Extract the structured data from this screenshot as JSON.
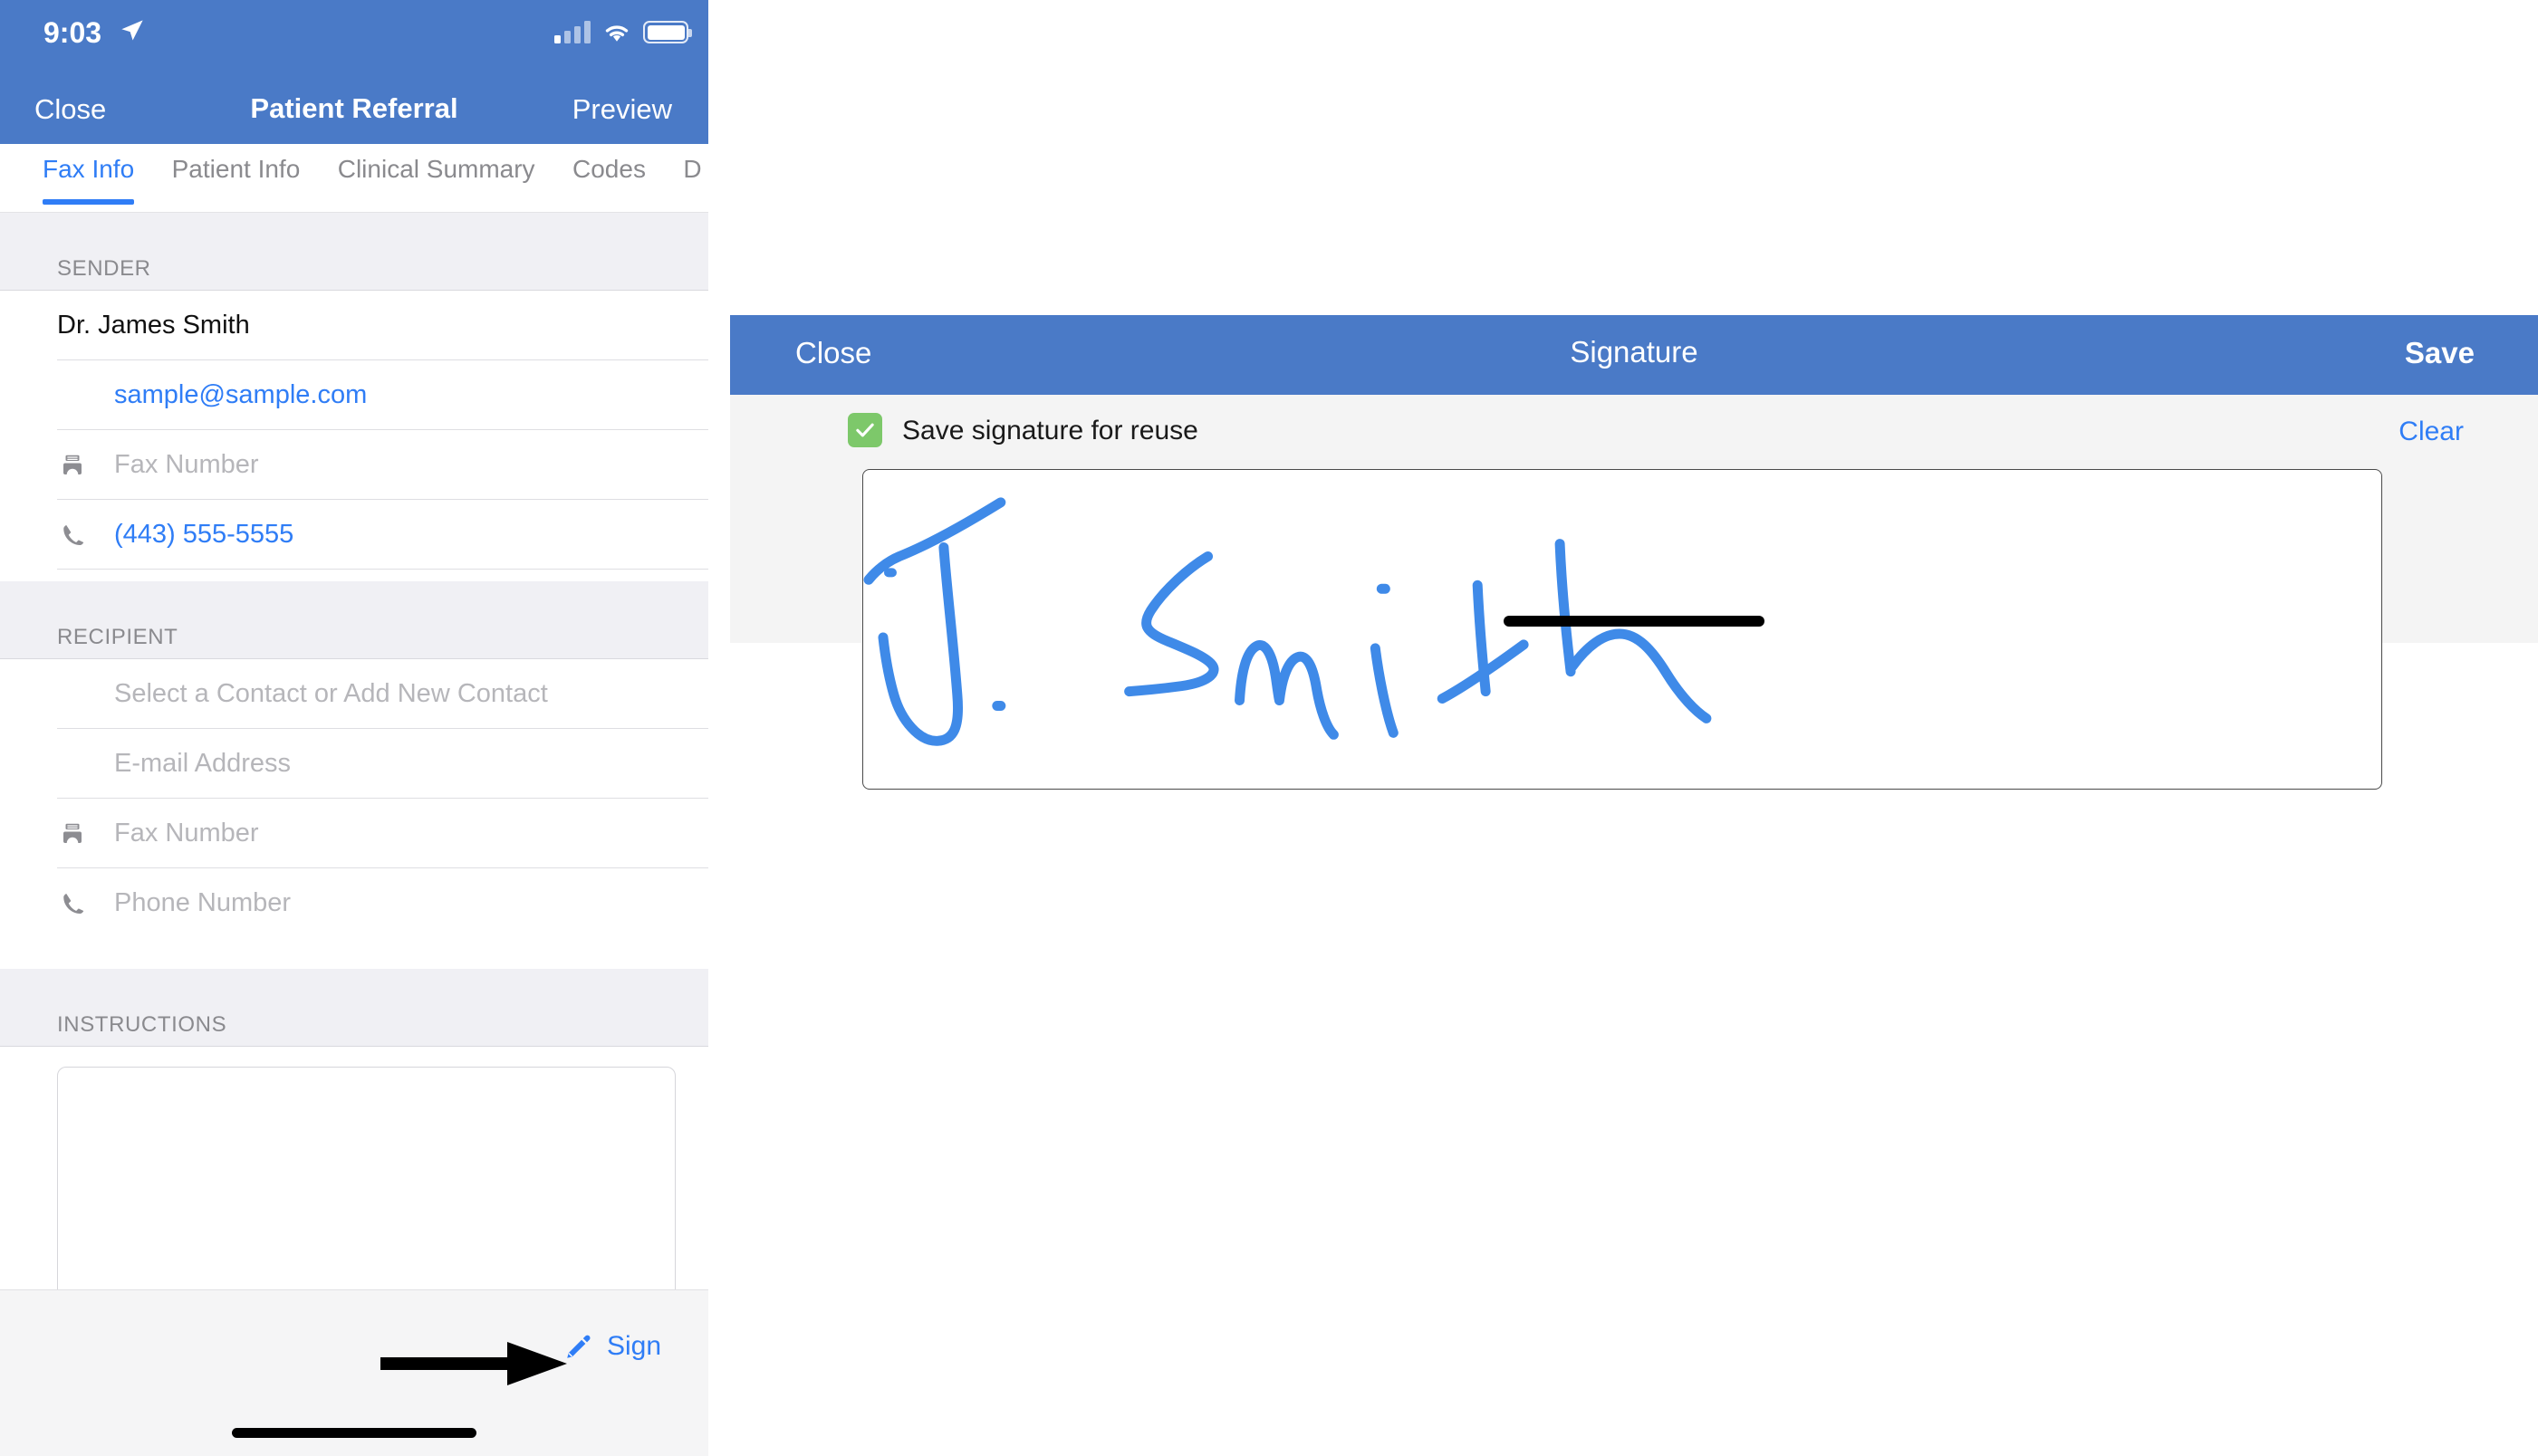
{
  "phone": {
    "status_bar": {
      "time": "9:03",
      "location_icon": "location-arrow-icon",
      "signal_icon": "cellular-signal-icon",
      "wifi_icon": "wifi-icon",
      "battery_icon": "battery-full-icon"
    },
    "nav": {
      "close_label": "Close",
      "title": "Patient Referral",
      "preview_label": "Preview"
    },
    "tabs": [
      {
        "label": "Fax Info",
        "active": true
      },
      {
        "label": "Patient Info",
        "active": false
      },
      {
        "label": "Clinical Summary",
        "active": false
      },
      {
        "label": "Codes",
        "active": false
      },
      {
        "label": "D",
        "active": false
      }
    ],
    "sender": {
      "header": "SENDER",
      "name_value": "Dr. James Smith",
      "email_value": "sample@sample.com",
      "fax_placeholder": "Fax Number",
      "fax_icon": "fax-machine-icon",
      "phone_value": "(443) 555-5555",
      "phone_icon": "phone-handset-icon"
    },
    "recipient": {
      "header": "RECIPIENT",
      "contact_placeholder": "Select a Contact or Add New Contact",
      "email_placeholder": "E-mail Address",
      "fax_placeholder": "Fax Number",
      "fax_icon": "fax-machine-icon",
      "phone_placeholder": "Phone Number",
      "phone_icon": "phone-handset-icon"
    },
    "instructions": {
      "header": "INSTRUCTIONS",
      "notes_value": ""
    },
    "sign_bar": {
      "sign_label": "Sign",
      "pen_icon": "pen-icon",
      "annotation_icon": "black-arrow-pointer"
    },
    "home_indicator": "home-indicator"
  },
  "signature_modal": {
    "nav": {
      "close_label": "Close",
      "title": "Signature",
      "save_label": "Save"
    },
    "save_for_reuse": {
      "label": "Save signature for reuse",
      "checked": true,
      "check_icon": "checkmark-icon"
    },
    "clear_label": "Clear",
    "canvas": {
      "drawn_text": "J. Smith",
      "ink_color": "#3f8ae8"
    },
    "home_indicator": "home-indicator"
  },
  "colors": {
    "header_blue": "#4a7ac7",
    "link_blue": "#2f7df6",
    "check_green": "#7dc86a",
    "section_bg": "#f0f0f4",
    "modal_bg": "#f4f4f4",
    "ink_blue": "#3f8ae8"
  }
}
